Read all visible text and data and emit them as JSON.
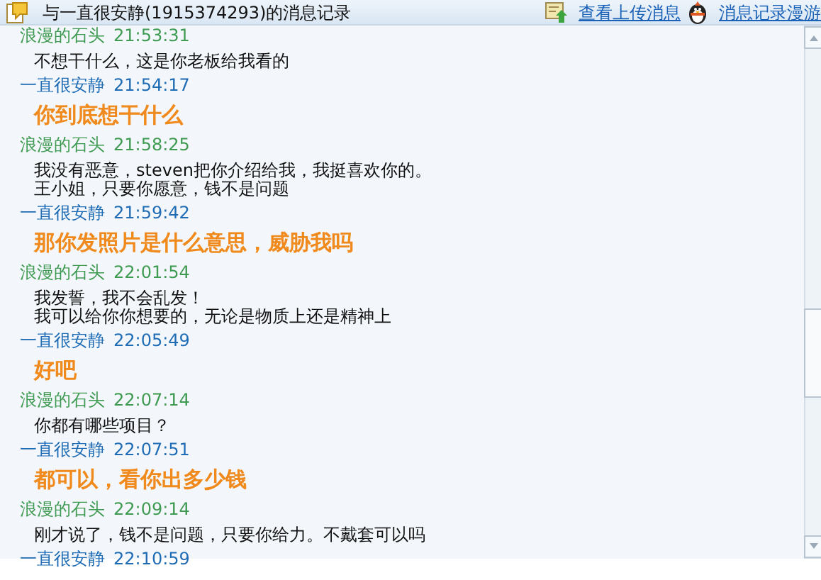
{
  "window": {
    "title": "与一直很安静(1915374293)的消息记录"
  },
  "toolbar_links": [
    {
      "label": "查看上传消息"
    },
    {
      "label": "消息记录漫游"
    }
  ],
  "messages": [
    {
      "sender": "浪漫的石头",
      "time": "21:53:31",
      "color": "#3f9a52",
      "kind": "plain",
      "lines": [
        "不想干什么，这是你老板给我看的"
      ]
    },
    {
      "sender": "一直很安静",
      "time": "21:54:17",
      "color": "#1f6cb5",
      "kind": "highlight",
      "lines": [
        "你到底想干什么"
      ]
    },
    {
      "sender": "浪漫的石头",
      "time": "21:58:25",
      "color": "#3f9a52",
      "kind": "plain",
      "lines": [
        "我没有恶意，steven把你介绍给我，我挺喜欢你的。",
        "王小姐，只要你愿意，钱不是问题"
      ]
    },
    {
      "sender": "一直很安静",
      "time": "21:59:42",
      "color": "#1f6cb5",
      "kind": "highlight",
      "lines": [
        "那你发照片是什么意思，威胁我吗"
      ]
    },
    {
      "sender": "浪漫的石头",
      "time": "22:01:54",
      "color": "#3f9a52",
      "kind": "plain",
      "lines": [
        "我发誓，我不会乱发！",
        "我可以给你你想要的，无论是物质上还是精神上"
      ]
    },
    {
      "sender": "一直很安静",
      "time": "22:05:49",
      "color": "#1f6cb5",
      "kind": "highlight",
      "lines": [
        "好吧"
      ]
    },
    {
      "sender": "浪漫的石头",
      "time": "22:07:14",
      "color": "#3f9a52",
      "kind": "plain",
      "lines": [
        "你都有哪些项目？"
      ]
    },
    {
      "sender": "一直很安静",
      "time": "22:07:51",
      "color": "#1f6cb5",
      "kind": "highlight",
      "lines": [
        "都可以，看你出多少钱"
      ]
    },
    {
      "sender": "浪漫的石头",
      "time": "22:09:14",
      "color": "#3f9a52",
      "kind": "plain",
      "lines": [
        "刚才说了，钱不是问题，只要你给力。不戴套可以吗"
      ]
    },
    {
      "sender": "一直很安静",
      "time": "22:10:59",
      "color": "#1f6cb5",
      "kind": "plain"
    }
  ]
}
